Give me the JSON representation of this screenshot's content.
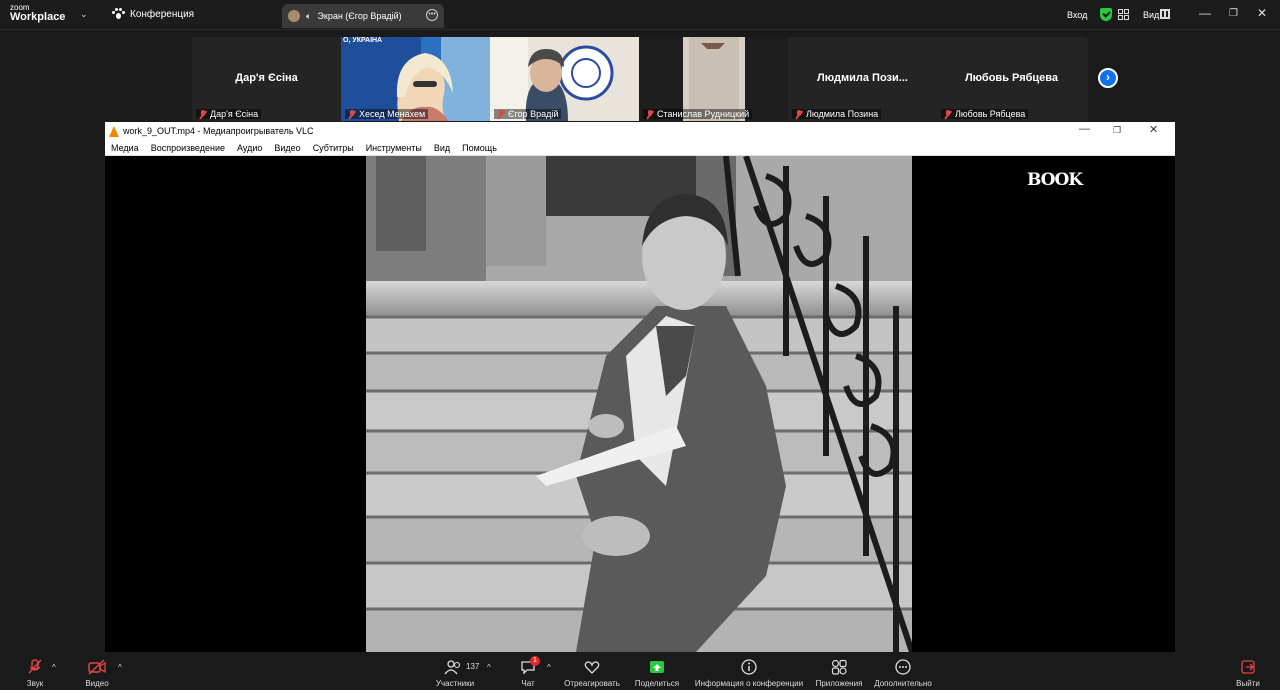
{
  "app": {
    "logo_small": "zoom",
    "logo_big": "Workplace",
    "tab_conference": "Конференция",
    "tab_share": "Экран (Єгор Врадій)",
    "signin": "Вход",
    "view_label": "Вид"
  },
  "participants": [
    {
      "name": "Дар'я Єсіна",
      "big_name": "Дар'я Єсіна",
      "video": false
    },
    {
      "name": "Хесед Менахем",
      "big_name": "",
      "video": true,
      "banner": "О, УКРАЇНА"
    },
    {
      "name": "Єгор Врадій",
      "big_name": "",
      "video": true
    },
    {
      "name": "Станислав Рудницкий",
      "big_name": "",
      "video": true,
      "active": true
    },
    {
      "name": "Людмила Позина",
      "big_name": "Людмила  Пози...",
      "video": false
    },
    {
      "name": "Любовь Рябцева",
      "big_name": "Любовь Рябцева",
      "video": false
    }
  ],
  "vlc": {
    "title": "work_9_OUT.mp4 - Медиапроигрыватель VLC",
    "menu": [
      "Медиа",
      "Воспроизведение",
      "Аудио",
      "Видео",
      "Субтитры",
      "Инструменты",
      "Вид",
      "Помощь"
    ],
    "watermark": "BOOK"
  },
  "toolbar": {
    "audio": "Звук",
    "video": "Видео",
    "participants": "Участники",
    "participants_count": "137",
    "chat": "Чат",
    "chat_badge": "1",
    "react": "Отреагировать",
    "share": "Поделиться",
    "info": "Информация о конференции",
    "apps": "Приложения",
    "more": "Дополнительно",
    "leave": "Выйти"
  },
  "colors": {
    "accent_blue": "#0e72ed",
    "active_speaker": "#3ccf63",
    "muted_red": "#e04646",
    "share_green": "#27c93f"
  }
}
